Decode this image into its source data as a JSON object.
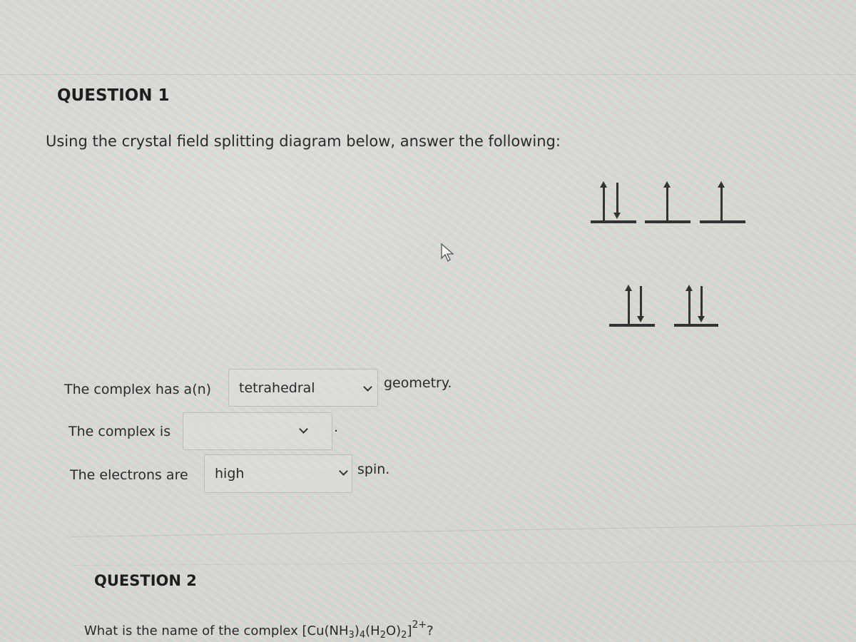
{
  "question1": {
    "title": "QUESTION 1",
    "prompt": "Using the crystal field splitting diagram below, answer the following:",
    "diagram": {
      "upper_orbitals": [
        {
          "electrons": [
            "up",
            "down"
          ]
        },
        {
          "electrons": [
            "up"
          ]
        },
        {
          "electrons": [
            "up"
          ]
        }
      ],
      "lower_orbitals": [
        {
          "electrons": [
            "up",
            "down"
          ]
        },
        {
          "electrons": [
            "up",
            "down"
          ]
        }
      ]
    },
    "statements": [
      {
        "prefix": "The complex has a(n)",
        "selected": "tetrahedral",
        "suffix": "geometry."
      },
      {
        "prefix": "The complex is",
        "selected": "",
        "suffix": "."
      },
      {
        "prefix": "The electrons are",
        "selected": "high",
        "suffix": "spin."
      }
    ]
  },
  "question2": {
    "title": "QUESTION 2",
    "prompt_text": "What is the name of the complex",
    "formula": {
      "open": "[Cu(NH",
      "sub1": "3",
      "mid1": ")",
      "sub2": "4",
      "mid2": "(H",
      "sub3": "2",
      "mid3": "O)",
      "sub4": "2",
      "close": "]",
      "charge": "2+",
      "end": "?"
    }
  }
}
